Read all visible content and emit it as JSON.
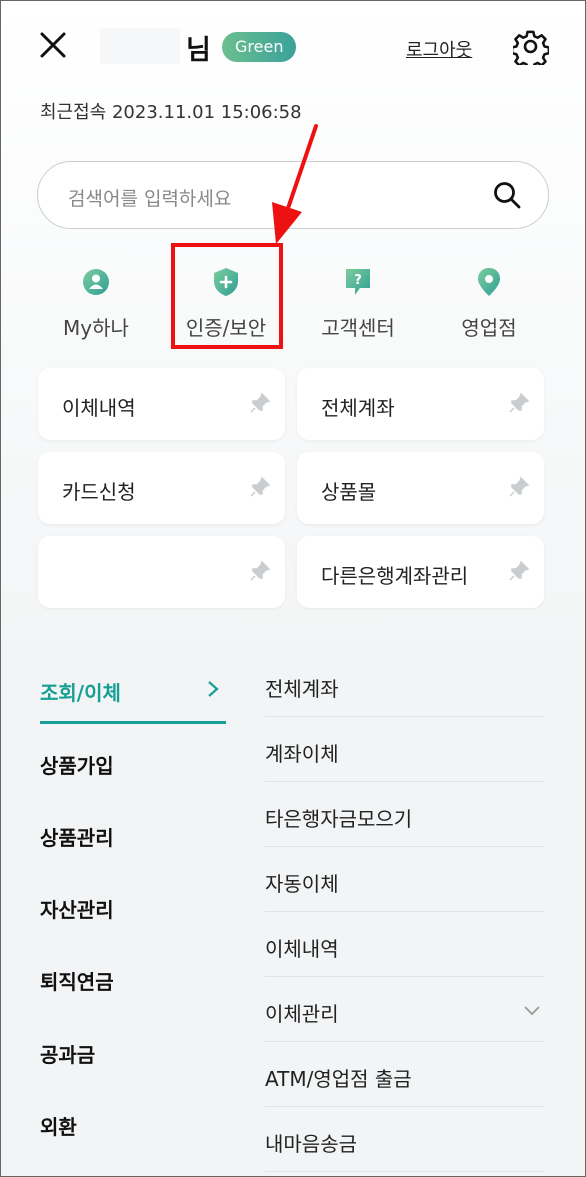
{
  "header": {
    "user_suffix": "님",
    "grade_badge": "Green",
    "logout_label": "로그아웃",
    "last_login": "최근접속 2023.11.01 15:06:58"
  },
  "search": {
    "placeholder": "검색어를 입력하세요"
  },
  "quick_menu": [
    {
      "label": "My하나",
      "icon": "person-icon"
    },
    {
      "label": "인증/보안",
      "icon": "shield-plus-icon"
    },
    {
      "label": "고객센터",
      "icon": "question-bubble-icon"
    },
    {
      "label": "영업점",
      "icon": "location-pin-icon"
    }
  ],
  "favorites": [
    {
      "label": "이체내역"
    },
    {
      "label": "전체계좌"
    },
    {
      "label": "카드신청"
    },
    {
      "label": "상품몰"
    },
    {
      "label": ""
    },
    {
      "label": "다른은행계좌관리"
    }
  ],
  "left_menu": [
    {
      "label": "조회/이체",
      "active": true
    },
    {
      "label": "상품가입"
    },
    {
      "label": "상품관리"
    },
    {
      "label": "자산관리"
    },
    {
      "label": "퇴직연금"
    },
    {
      "label": "공과금"
    },
    {
      "label": "외환"
    }
  ],
  "right_menu": [
    {
      "label": "전체계좌"
    },
    {
      "label": "계좌이체"
    },
    {
      "label": "타은행자금모으기"
    },
    {
      "label": "자동이체"
    },
    {
      "label": "이체내역"
    },
    {
      "label": "이체관리",
      "expandable": true
    },
    {
      "label": "ATM/영업점 출금"
    },
    {
      "label": "내마음송금"
    }
  ],
  "colors": {
    "accent": "#16a095",
    "highlight": "#ee1111",
    "badge_start": "#6bbf8f",
    "badge_end": "#3aa29a"
  }
}
